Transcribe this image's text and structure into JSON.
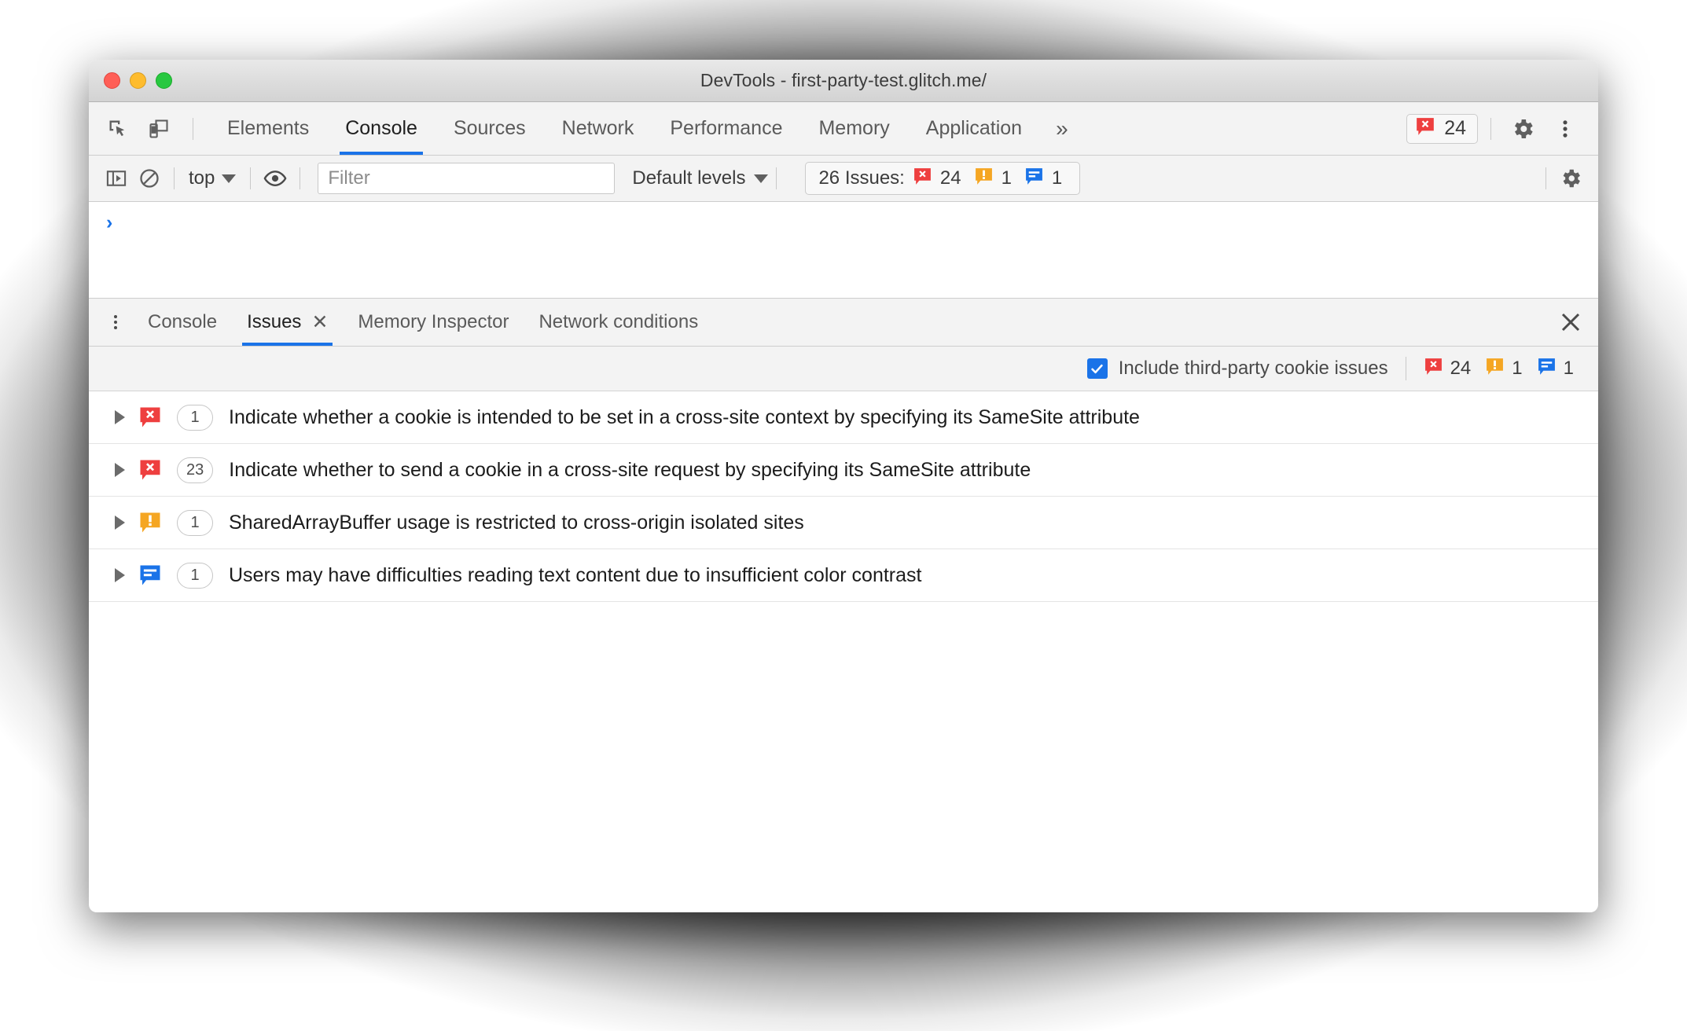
{
  "window": {
    "title": "DevTools - first-party-test.glitch.me/",
    "traffic_lights": [
      "close",
      "minimize",
      "zoom"
    ]
  },
  "colors": {
    "accent": "#1a73e8",
    "error": "#ee3f3f",
    "warning": "#f5a623",
    "info": "#1a73e8",
    "toolbar_bg": "#f3f3f3",
    "panel_bg": "#ffffff"
  },
  "main_tabs": {
    "items": [
      {
        "label": "Elements",
        "active": false
      },
      {
        "label": "Console",
        "active": true
      },
      {
        "label": "Sources",
        "active": false
      },
      {
        "label": "Network",
        "active": false
      },
      {
        "label": "Performance",
        "active": false
      },
      {
        "label": "Memory",
        "active": false
      },
      {
        "label": "Application",
        "active": false
      }
    ],
    "more_label": "»",
    "error_badge": {
      "icon": "error-bubble-icon",
      "count": "24"
    },
    "settings_icon": "gear-icon",
    "menu_icon": "kebab-menu-icon",
    "inspect_icon": "inspect-cursor-icon",
    "device_icon": "device-toolbar-icon"
  },
  "console_toolbar": {
    "sidebar_icon": "console-sidebar-icon",
    "clear_icon": "clear-console-icon",
    "context": {
      "label": "top",
      "caret": "chevron-down-icon"
    },
    "eye_icon": "live-expression-eye-icon",
    "filter": {
      "placeholder": "Filter",
      "value": ""
    },
    "levels": {
      "label": "Default levels",
      "caret": "chevron-down-icon"
    },
    "issues_summary": {
      "label": "26 Issues:",
      "errors": "24",
      "warnings": "1",
      "infos": "1"
    },
    "settings_icon": "gear-icon"
  },
  "console_output": {
    "prompt": "›"
  },
  "drawer": {
    "menu_icon": "kebab-menu-icon",
    "tabs": [
      {
        "label": "Console",
        "active": false,
        "closable": false
      },
      {
        "label": "Issues",
        "active": true,
        "closable": true,
        "close_glyph": "✕"
      },
      {
        "label": "Memory Inspector",
        "active": false,
        "closable": false
      },
      {
        "label": "Network conditions",
        "active": false,
        "closable": false
      }
    ],
    "close_icon": "close-drawer-icon"
  },
  "issues_options": {
    "third_party_checkbox": {
      "label": "Include third-party cookie issues",
      "checked": true
    },
    "counts": {
      "errors": "24",
      "warnings": "1",
      "infos": "1"
    }
  },
  "issues": [
    {
      "severity": "error",
      "count": "1",
      "title": "Indicate whether a cookie is intended to be set in a cross-site context by specifying its SameSite attribute",
      "expanded": false
    },
    {
      "severity": "error",
      "count": "23",
      "title": "Indicate whether to send a cookie in a cross-site request by specifying its SameSite attribute",
      "expanded": false
    },
    {
      "severity": "warning",
      "count": "1",
      "title": "SharedArrayBuffer usage is restricted to cross-origin isolated sites",
      "expanded": false
    },
    {
      "severity": "info",
      "count": "1",
      "title": "Users may have difficulties reading text content due to insufficient color contrast",
      "expanded": false
    }
  ]
}
